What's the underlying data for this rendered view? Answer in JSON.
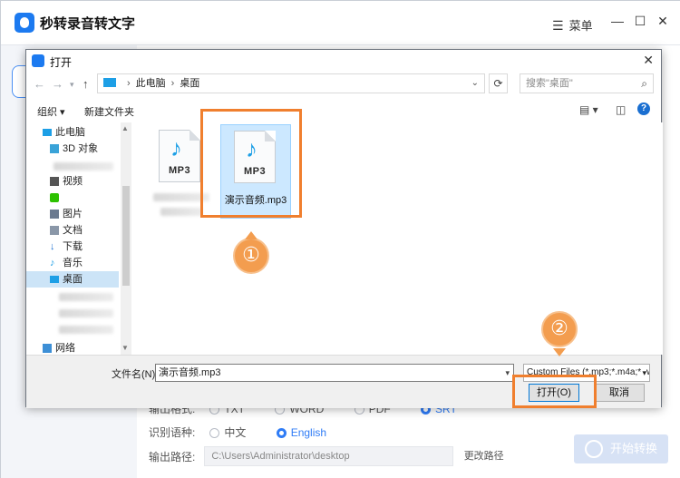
{
  "app": {
    "title": "秒转录音转文字",
    "menu_label": "菜单",
    "options": {
      "format_label": "输出格式:",
      "formats": [
        "TXT",
        "WORD",
        "PDF",
        "SRT"
      ],
      "language_label": "识别语种:",
      "languages": [
        "中文",
        "English"
      ],
      "selected_language": "English",
      "path_label": "输出路径:",
      "path_value": "C:\\Users\\Administrator\\desktop",
      "change_path": "更改路径"
    },
    "start_button": "开始转换"
  },
  "dialog": {
    "title": "打开",
    "breadcrumb": [
      "此电脑",
      "桌面"
    ],
    "search_placeholder": "搜索\"桌面\"",
    "toolbar": {
      "organize": "组织 ▾",
      "new_folder": "新建文件夹"
    },
    "nav": {
      "this_pc": "此电脑",
      "items": [
        "3D 对象",
        "视频",
        "图片",
        "文档",
        "下载",
        "音乐",
        "桌面"
      ],
      "network": "网络"
    },
    "files": [
      {
        "name": "",
        "type": "MP3",
        "selected": false
      },
      {
        "name": "演示音频.mp3",
        "type": "MP3",
        "selected": true
      }
    ],
    "filename_label": "文件名(N):",
    "filename_value": "演示音频.mp3",
    "filter_value": "Custom Files (*.mp3;*.m4a;*.w",
    "open_button": "打开(O)",
    "cancel_button": "取消"
  },
  "annotations": {
    "step1": "①",
    "step2": "②",
    "color": "#f07f2e"
  }
}
